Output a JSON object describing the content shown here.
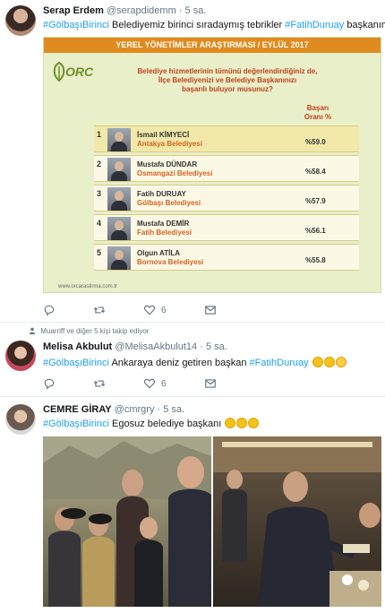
{
  "tweet1": {
    "name": "Serap Erdem",
    "handle": "@serapdidemm",
    "dot": "·",
    "time": "5 sa.",
    "hashtag": "#GölbaşıBirinci",
    "text": "Belediyemiz birinci sıradaymış tebrikler",
    "mention_tag": "#FatihDuruay",
    "text_end": "başkanımm",
    "like_count": "6"
  },
  "card": {
    "banner": "YEREL YÖNETİMLER ARAŞTIRMASI / EYLÜL 2017",
    "logo": "ORC",
    "question_line1": "Belediye hizmetlerinin tümünü değerlendirdiğiniz de,",
    "question_line2": "İlçe Belediyenizi ve Belediye Başkanınızı",
    "question_line3": "başarılı buluyor musunuz?",
    "col_head_line1": "Başarı",
    "col_head_line2": "Oranı %",
    "rows": [
      {
        "rank": "1",
        "name": "İsmail KİMYECİ",
        "muni": "Antakya Belediyesi",
        "pct": "%59.0"
      },
      {
        "rank": "2",
        "name": "Mustafa DÜNDAR",
        "muni": "Osmangazi Belediyesi",
        "pct": "%58.4"
      },
      {
        "rank": "3",
        "name": "Fatih DURUAY",
        "muni": "Gölbaşı Belediyesi",
        "pct": "%57.9"
      },
      {
        "rank": "4",
        "name": "Mustafa DEMİR",
        "muni": "Fatih Belediyesi",
        "pct": "%56.1"
      },
      {
        "rank": "5",
        "name": "Olgun ATİLA",
        "muni": "Bornova Belediyesi",
        "pct": "%55.8"
      }
    ],
    "footer": "www.orcarastirma.com.tr"
  },
  "follow_note": "Muarriff ve diğer 5 kişi takip ediyor",
  "tweet2": {
    "name": "Melisa Akbulut",
    "handle": "@MelisaAkbulut14",
    "dot": "·",
    "time": "5 sa.",
    "hashtag": "#GölbaşıBirinci",
    "text": "Ankaraya deniz getiren başkan",
    "mention_tag": "#FatihDuruay",
    "like_count": "6"
  },
  "tweet3": {
    "name": "CEMRE GİRAY",
    "handle": "@cmrgry",
    "dot": "·",
    "time": "5 sa.",
    "hashtag": "#GölbaşıBirinci",
    "text": "Egosuz belediye başkanı"
  },
  "colors": {
    "link": "#1da1f2",
    "banner": "#e08b1f",
    "card_bg": "#e8efc9",
    "muni": "#d6621e"
  },
  "icons": [
    "reply-icon",
    "retweet-icon",
    "like-icon",
    "message-icon",
    "person-icon"
  ]
}
